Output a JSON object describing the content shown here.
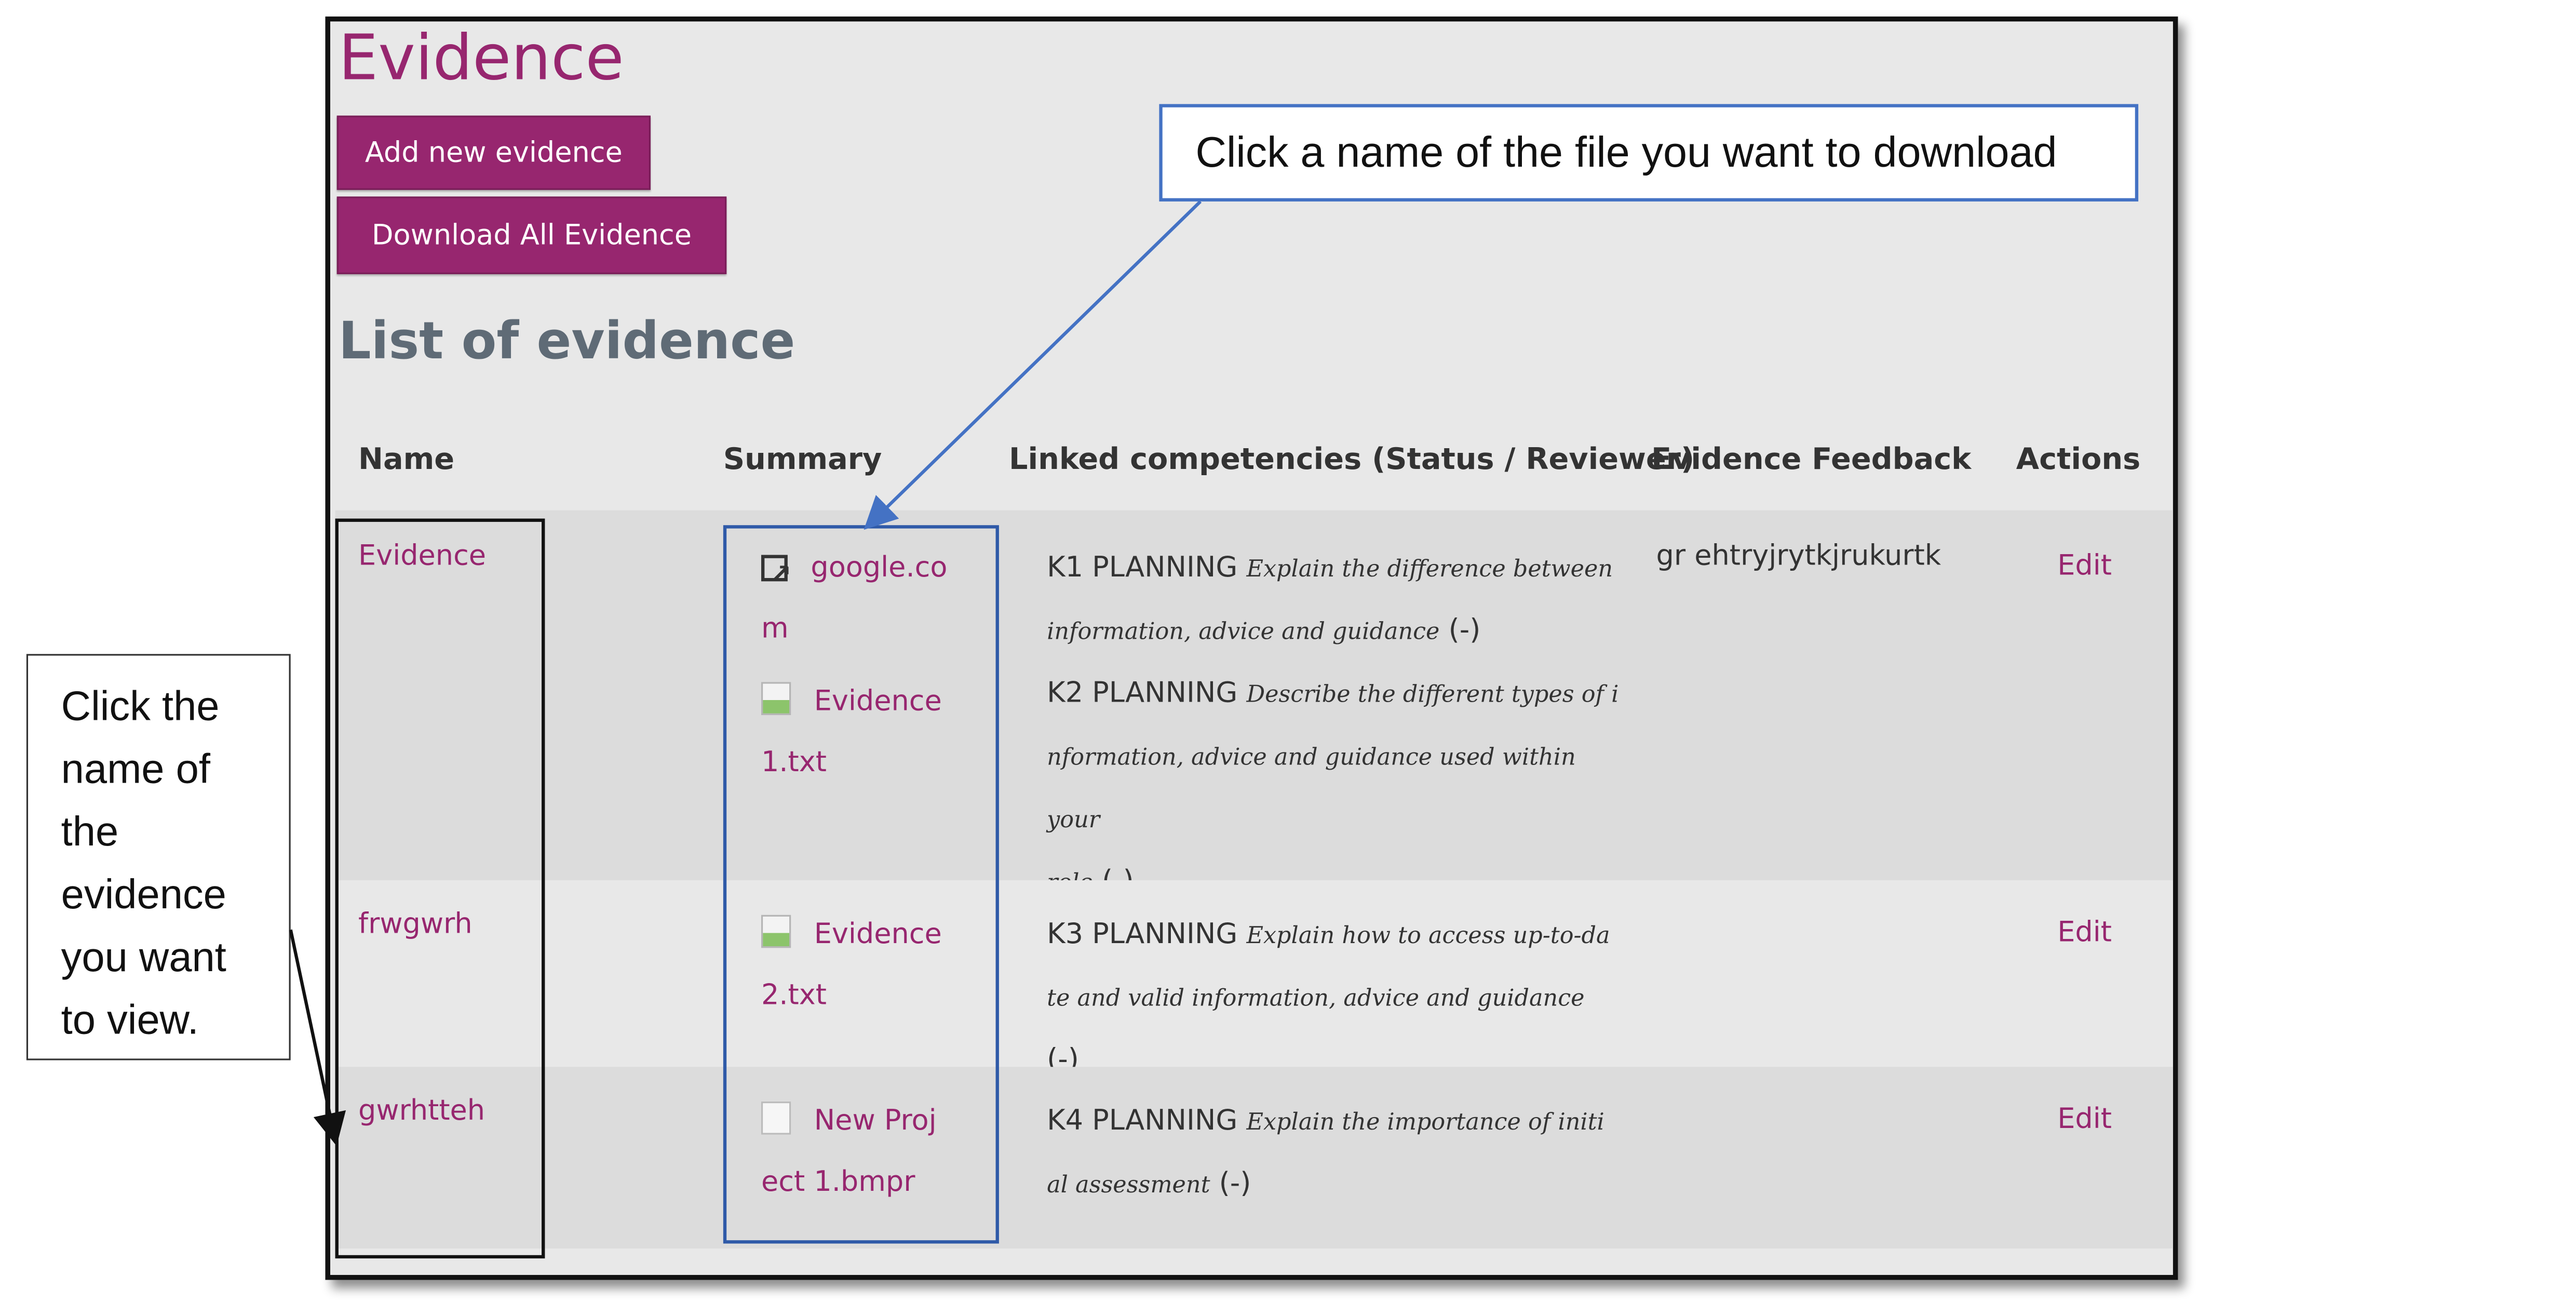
{
  "page": {
    "title": "Evidence",
    "add_button": "Add new evidence",
    "download_button": "Download All Evidence",
    "list_title": "List of evidence"
  },
  "table": {
    "headers": [
      "Name",
      "Summary",
      "Linked competencies (Status / Reviewer)",
      "Evidence Feedback",
      "Actions"
    ],
    "rows": [
      {
        "name": "Evidence",
        "files": [
          {
            "icon": "external-link-icon",
            "line1": "google.co",
            "line2": "m"
          },
          {
            "icon": "text-file-icon",
            "line1": "Evidence",
            "line2": "1.txt"
          }
        ],
        "competencies": [
          {
            "code": "K1 PLANNING",
            "desc_1": "Explain the difference between",
            "desc_2": "information, advice and guidance",
            "status": "(-)"
          },
          {
            "code": "K2 PLANNING",
            "desc_1": "Describe the different types of i",
            "desc_2": "nformation, advice and guidance used within your",
            "desc_3": "role",
            "status": "(-)"
          }
        ],
        "feedback": "gr ehtryjrytkjrukurtk",
        "action": "Edit"
      },
      {
        "name": "frwgwrh",
        "files": [
          {
            "icon": "text-file-icon",
            "line1": "Evidence",
            "line2": "2.txt"
          }
        ],
        "competencies": [
          {
            "code": "K3 PLANNING",
            "desc_1": "Explain how to access up-to-da",
            "desc_2": "te and valid information, advice and guidance",
            "status": "(-)"
          }
        ],
        "feedback": "",
        "action": "Edit"
      },
      {
        "name": "gwrhtteh",
        "files": [
          {
            "icon": "blank-file-icon",
            "line1": "New Proj",
            "line2": "ect 1.bmpr"
          }
        ],
        "competencies": [
          {
            "code": "K4 PLANNING",
            "desc_1": "Explain the importance of initi",
            "desc_2": "al assessment",
            "status": "(-)"
          }
        ],
        "feedback": "",
        "action": "Edit"
      }
    ]
  },
  "callouts": {
    "top": "Click a name of the file you want to download",
    "left": [
      "Click the",
      "name of",
      "the",
      "evidence",
      "you want",
      "to view."
    ]
  },
  "colors": {
    "accent": "#97266f",
    "heading_gray": "#5f6b76",
    "callout_blue": "#4472c4"
  }
}
